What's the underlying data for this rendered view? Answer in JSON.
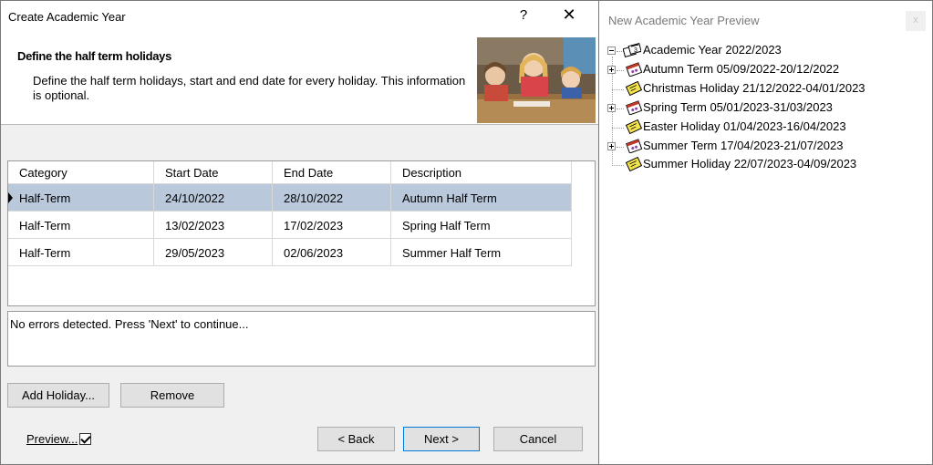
{
  "dialog": {
    "title": "Create Academic Year",
    "help_glyph": "?",
    "close_glyph": "✕",
    "header": {
      "title": "Define the half term holidays",
      "description": "Define the half term holidays, start and end date for every holiday. This information is optional."
    },
    "grid": {
      "columns": [
        "Category",
        "Start Date",
        "End Date",
        "Description"
      ],
      "rows": [
        {
          "category": "Half-Term",
          "start": "24/10/2022",
          "end": "28/10/2022",
          "description": "Autumn Half Term"
        },
        {
          "category": "Half-Term",
          "start": "13/02/2023",
          "end": "17/02/2023",
          "description": "Spring Half Term"
        },
        {
          "category": "Half-Term",
          "start": "29/05/2023",
          "end": "02/06/2023",
          "description": "Summer Half Term"
        }
      ]
    },
    "message": "No errors detected. Press 'Next' to continue...",
    "buttons": {
      "add_holiday": "Add Holiday...",
      "remove": "Remove",
      "back": "< Back",
      "next": "Next >",
      "cancel": "Cancel"
    },
    "preview": {
      "label": "Preview...",
      "checked": true
    }
  },
  "panel": {
    "title": "New Academic Year Preview",
    "close_glyph": "x",
    "tree": {
      "root": "Academic Year 2022/2023",
      "items": [
        {
          "label": "Autumn Term 05/09/2022-20/12/2022",
          "icon": "term-calendar-icon",
          "expandable": true
        },
        {
          "label": "Christmas Holiday 21/12/2022-04/01/2023",
          "icon": "holiday-note-icon",
          "expandable": false
        },
        {
          "label": "Spring Term 05/01/2023-31/03/2023",
          "icon": "term-calendar-icon",
          "expandable": true
        },
        {
          "label": "Easter Holiday 01/04/2023-16/04/2023",
          "icon": "holiday-note-icon",
          "expandable": false
        },
        {
          "label": "Summer Term 17/04/2023-21/07/2023",
          "icon": "term-calendar-icon",
          "expandable": true
        },
        {
          "label": "Summer Holiday 22/07/2023-04/09/2023",
          "icon": "holiday-note-icon",
          "expandable": false
        }
      ]
    }
  },
  "colors": {
    "selected_row": "#b9c9db",
    "dialog_bg": "#f0f0f0",
    "primary_border": "#0078d7"
  }
}
